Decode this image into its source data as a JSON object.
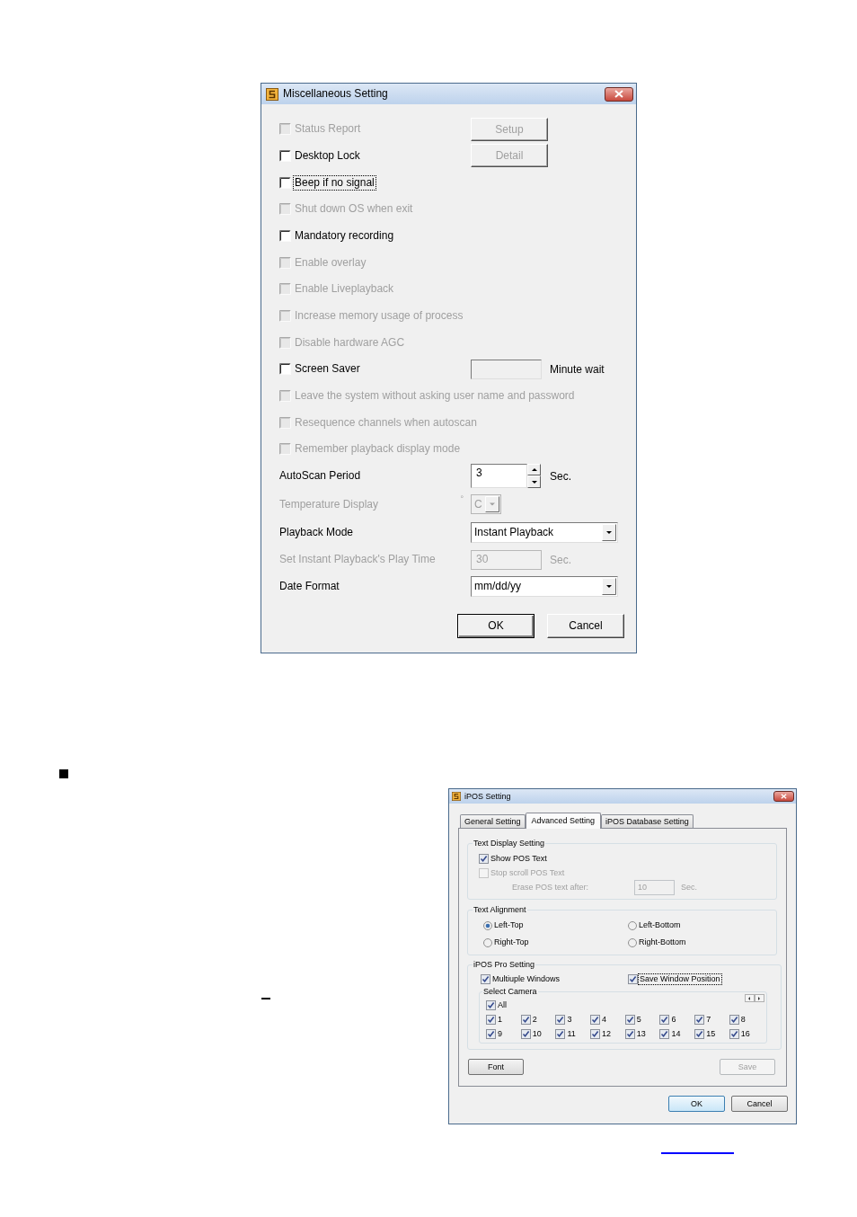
{
  "misc_dialog": {
    "title": "Miscellaneous Setting",
    "rows": [
      {
        "kind": "checkbox",
        "label": "Status Report",
        "checked": false,
        "disabled": true,
        "focused": false,
        "button": {
          "label": "Setup",
          "disabled": true
        }
      },
      {
        "kind": "checkbox",
        "label": "Desktop Lock",
        "checked": false,
        "disabled": false,
        "focused": false,
        "button": {
          "label": "Detail",
          "disabled": true
        }
      },
      {
        "kind": "checkbox",
        "label": "Beep if no signal",
        "checked": false,
        "disabled": false,
        "focused": true
      },
      {
        "kind": "checkbox",
        "label": "Shut down OS when exit",
        "checked": false,
        "disabled": true,
        "focused": false
      },
      {
        "kind": "checkbox",
        "label": "Mandatory recording",
        "checked": false,
        "disabled": false,
        "focused": false
      },
      {
        "kind": "checkbox",
        "label": "Enable overlay",
        "checked": false,
        "disabled": true,
        "focused": false
      },
      {
        "kind": "checkbox",
        "label": "Enable Liveplayback",
        "checked": false,
        "disabled": true,
        "focused": false
      },
      {
        "kind": "checkbox",
        "label": "Increase memory usage of process",
        "checked": false,
        "disabled": true,
        "focused": false
      },
      {
        "kind": "checkbox",
        "label": "Disable hardware AGC",
        "checked": false,
        "disabled": true,
        "focused": false
      },
      {
        "kind": "checkbox",
        "label": "Screen Saver",
        "checked": false,
        "disabled": false,
        "focused": false,
        "field": {
          "disabled": true,
          "unit": "Minute wait"
        }
      },
      {
        "kind": "checkbox",
        "label": "Leave the system without asking user name and password",
        "checked": false,
        "disabled": true,
        "focused": false
      },
      {
        "kind": "checkbox",
        "label": "Resequence channels when autoscan",
        "checked": false,
        "disabled": true,
        "focused": false
      },
      {
        "kind": "checkbox",
        "label": "Remember playback display mode",
        "checked": false,
        "disabled": true,
        "focused": false
      },
      {
        "kind": "spin",
        "label": "AutoScan Period",
        "disabled": false,
        "value": "3",
        "unit": "Sec."
      },
      {
        "kind": "combo",
        "label": "Temperature Display",
        "disabled": true,
        "prefix": "°",
        "value": "C"
      },
      {
        "kind": "dropdown",
        "label": "Playback Mode",
        "disabled": false,
        "value": "Instant Playback"
      },
      {
        "kind": "field",
        "label": "Set Instant Playback's Play Time",
        "disabled": true,
        "value": "30",
        "unit": "Sec."
      },
      {
        "kind": "dropdown",
        "label": "Date Format",
        "disabled": false,
        "value": "mm/dd/yy"
      }
    ],
    "buttons": [
      {
        "label": "OK",
        "default": true
      },
      {
        "label": "Cancel",
        "default": false
      }
    ]
  },
  "ipos_dialog": {
    "title": "iPOS Setting",
    "tabs": [
      {
        "label": "General Setting",
        "selected": false
      },
      {
        "label": "Advanced Setting",
        "selected": true
      },
      {
        "label": "iPOS Database Setting",
        "selected": false
      }
    ],
    "text_display": {
      "title": "Text Display Setting",
      "options": [
        {
          "label": "Show POS Text",
          "checked": true,
          "disabled": false
        },
        {
          "label": "Stop scroll POS Text",
          "checked": false,
          "disabled": true
        }
      ],
      "erase": {
        "label": "Erase POS text after:",
        "value": "10",
        "unit": "Sec.",
        "disabled": true
      }
    },
    "text_alignment": {
      "title": "Text Alignment",
      "options": [
        {
          "label": "Left-Top",
          "selected": true
        },
        {
          "label": "Left-Bottom",
          "selected": false
        },
        {
          "label": "Right-Top",
          "selected": false
        },
        {
          "label": "Right-Bottom",
          "selected": false
        }
      ]
    },
    "pro": {
      "title": "iPOS Pro Setting",
      "options": [
        {
          "label": "Multiuple Windows",
          "checked": true,
          "focused": false
        },
        {
          "label": "Save Window Position",
          "checked": true,
          "focused": true
        }
      ],
      "camera": {
        "title": "Select Camera",
        "all": {
          "label": "All",
          "checked": true
        },
        "cameras": [
          {
            "label": "1",
            "checked": true
          },
          {
            "label": "2",
            "checked": true
          },
          {
            "label": "3",
            "checked": true
          },
          {
            "label": "4",
            "checked": true
          },
          {
            "label": "5",
            "checked": true
          },
          {
            "label": "6",
            "checked": true
          },
          {
            "label": "7",
            "checked": true
          },
          {
            "label": "8",
            "checked": true
          },
          {
            "label": "9",
            "checked": true
          },
          {
            "label": "10",
            "checked": true
          },
          {
            "label": "11",
            "checked": true
          },
          {
            "label": "12",
            "checked": true
          },
          {
            "label": "13",
            "checked": true
          },
          {
            "label": "14",
            "checked": true
          },
          {
            "label": "15",
            "checked": true
          },
          {
            "label": "16",
            "checked": true
          }
        ]
      }
    },
    "actions": [
      {
        "label": "Font",
        "disabled": false
      },
      {
        "label": "Save",
        "disabled": true
      }
    ],
    "buttons": [
      {
        "label": "OK",
        "default": true
      },
      {
        "label": "Cancel",
        "default": false
      }
    ]
  }
}
